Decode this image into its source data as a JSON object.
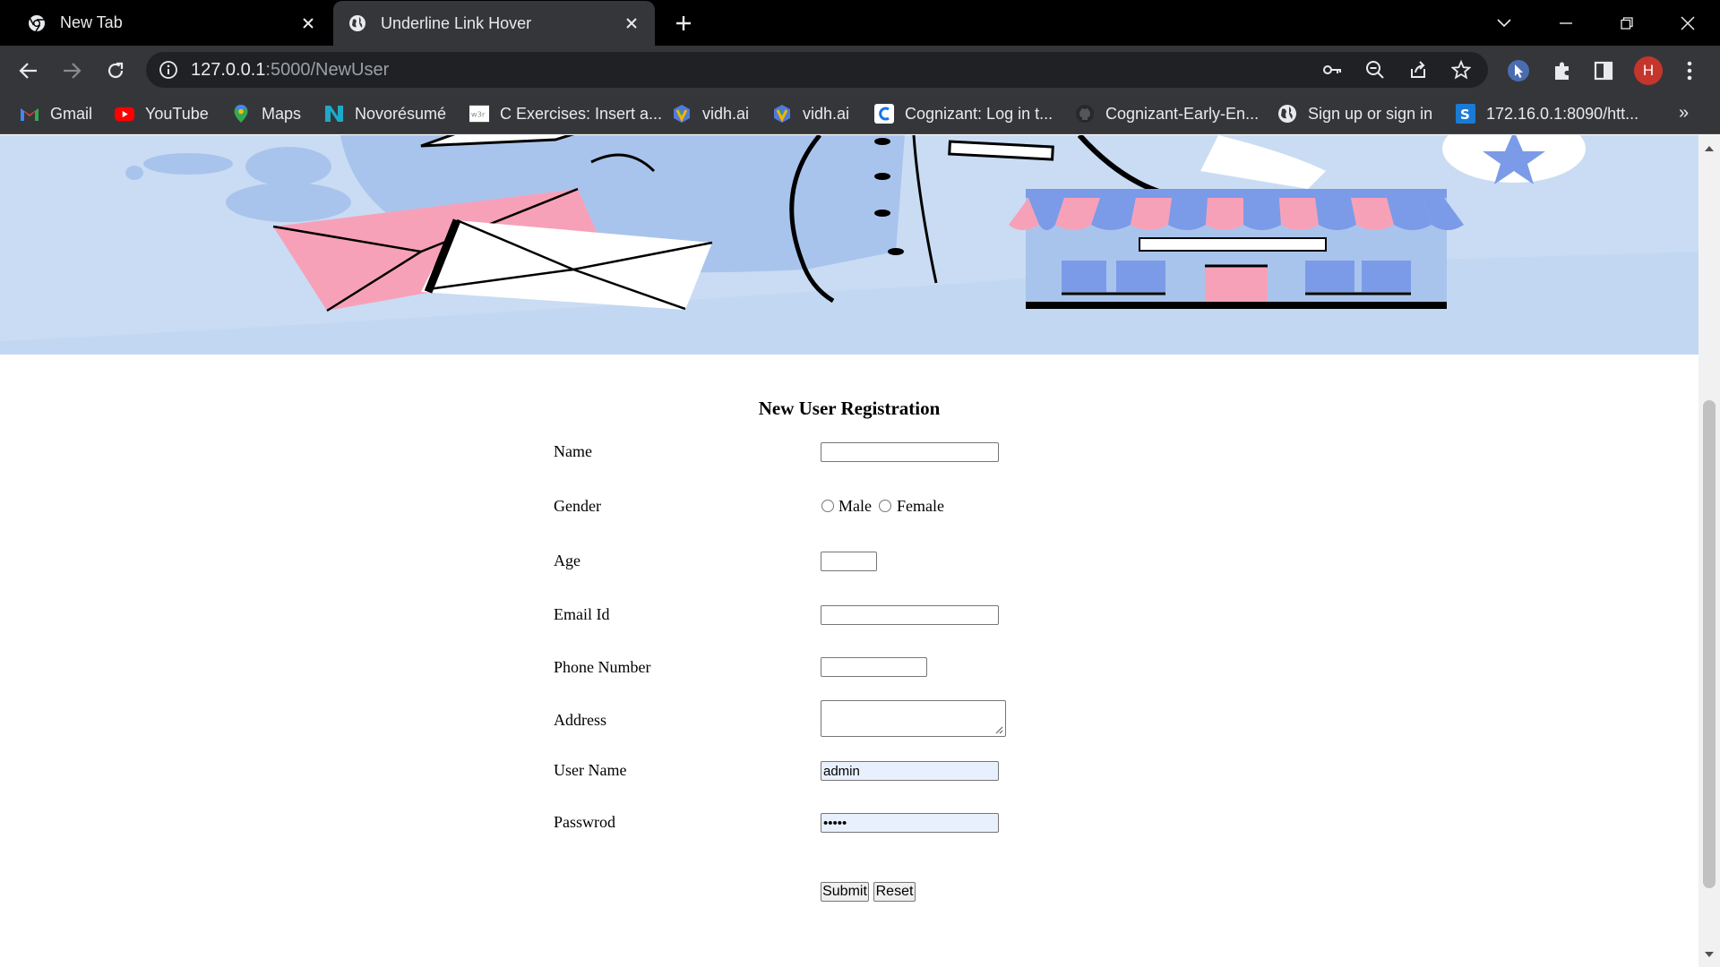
{
  "browser": {
    "tabs": [
      {
        "title": "New Tab",
        "icon": "chrome-icon",
        "active": false
      },
      {
        "title": "Underline Link Hover",
        "icon": "globe-icon",
        "active": true
      }
    ],
    "address": {
      "host": "127.0.0.1",
      "rest": ":5000/NewUser"
    },
    "profile_initial": "H",
    "bookmarks": [
      {
        "label": "Gmail",
        "icon": "gmail-icon"
      },
      {
        "label": "YouTube",
        "icon": "youtube-icon"
      },
      {
        "label": "Maps",
        "icon": "maps-icon"
      },
      {
        "label": "Novorésumé",
        "icon": "novoresume-icon"
      },
      {
        "label": "C Exercises: Insert a...",
        "icon": "w3resource-icon"
      },
      {
        "label": "vidh.ai",
        "icon": "vidhai-icon"
      },
      {
        "label": "vidh.ai",
        "icon": "vidhai-icon"
      },
      {
        "label": "Cognizant: Log in t...",
        "icon": "cognizant-icon"
      },
      {
        "label": "Cognizant-Early-En...",
        "icon": "github-icon"
      },
      {
        "label": "Sign up or sign in",
        "icon": "globe-icon"
      },
      {
        "label": "172.16.0.1:8090/htt...",
        "icon": "sophos-icon"
      }
    ],
    "bookmarks_overflow": "»",
    "colors": {
      "frame": "#000000",
      "toolbar": "#35363a",
      "omnibox": "#202124",
      "avatar": "#c5352c"
    }
  },
  "page": {
    "banner": {
      "colors": {
        "background": "#c9dcf3",
        "pink": "#f7a1b8",
        "blue": "#7b9be8",
        "light": "#a9c4ec"
      }
    },
    "form": {
      "title": "New User Registration",
      "name_label": "Name",
      "name_value": "",
      "gender_label": "Gender",
      "gender_options": [
        "Male",
        "Female"
      ],
      "age_label": "Age",
      "age_value": "",
      "email_label": "Email Id",
      "email_value": "",
      "phone_label": "Phone Number",
      "phone_value": "",
      "address_label": "Address",
      "address_value": "",
      "username_label": "User Name",
      "username_value": "admin",
      "password_label": "Passwrod",
      "password_value": "•••••",
      "submit_label": "Submit",
      "reset_label": "Reset",
      "autofill_color": "#e8f0fe"
    }
  }
}
